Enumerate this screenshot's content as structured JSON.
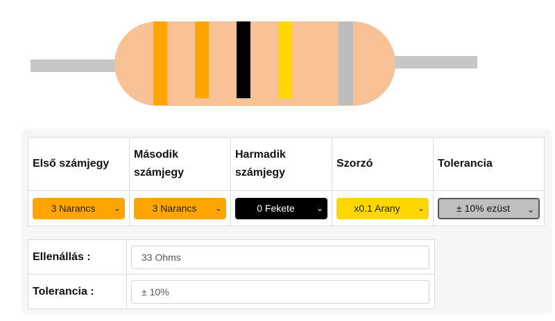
{
  "headers": [
    "Első számjegy",
    "Második számjegy",
    "Harmadik számjegy",
    "Szorzó",
    "Tolerancia"
  ],
  "selects": [
    {
      "value": "3 Narancs",
      "color": "#ffa500"
    },
    {
      "value": "3 Narancs",
      "color": "#ffa500"
    },
    {
      "value": "0 Fekete",
      "color": "#000000"
    },
    {
      "value": "x0.1 Arany",
      "color": "#ffd700"
    },
    {
      "value": "± 10% ezüst",
      "color": "#bfbfbf"
    }
  ],
  "result": {
    "resistance_label": "Ellenállás :",
    "resistance_value": "33 Ohms",
    "tolerance_label": "Tolerancia :",
    "tolerance_value": "± 10%"
  },
  "resistor": {
    "band_colors": [
      "#ffa500",
      "#ffa500",
      "#000000",
      "#ffd700",
      "#bdbdbd"
    ],
    "body_color": "#f8c195",
    "lead_color": "#c6c6c6"
  }
}
